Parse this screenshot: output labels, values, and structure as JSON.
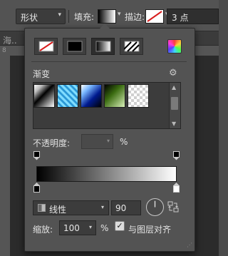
{
  "optionsBar": {
    "mode": "形状",
    "fill_label": "填充:",
    "stroke_label": "描边:",
    "stroke_size": "3 点"
  },
  "document": {
    "tab_text": "海..",
    "ruler_mark": "8"
  },
  "panel": {
    "fill_types": [
      "none",
      "solid",
      "gradient",
      "pattern"
    ],
    "active_fill_type": "gradient",
    "section_title": "渐变",
    "presets": [
      "black-white-diagonal",
      "cyan-pattern",
      "blue-gradient",
      "green-black",
      "transparent-checker"
    ],
    "opacity_label": "不透明度:",
    "opacity_value": "",
    "percent": "%",
    "gradient_method": "线性",
    "angle": "90",
    "scale_label": "缩放:",
    "scale_value": "100",
    "scale_unit": "%",
    "align_with_layer_label": "与图层对齐",
    "align_with_layer_checked": true,
    "gradient_stops": {
      "color": [
        {
          "pos": 0,
          "color": "#000000"
        },
        {
          "pos": 1,
          "color": "#ffffff"
        }
      ],
      "opacity": [
        {
          "pos": 0
        },
        {
          "pos": 1
        }
      ]
    }
  },
  "colors": {
    "panel_bg": "#535353",
    "field_bg": "#3c3c3c",
    "text": "#e3e3e3",
    "stroke_accent": "#d81e1e"
  }
}
